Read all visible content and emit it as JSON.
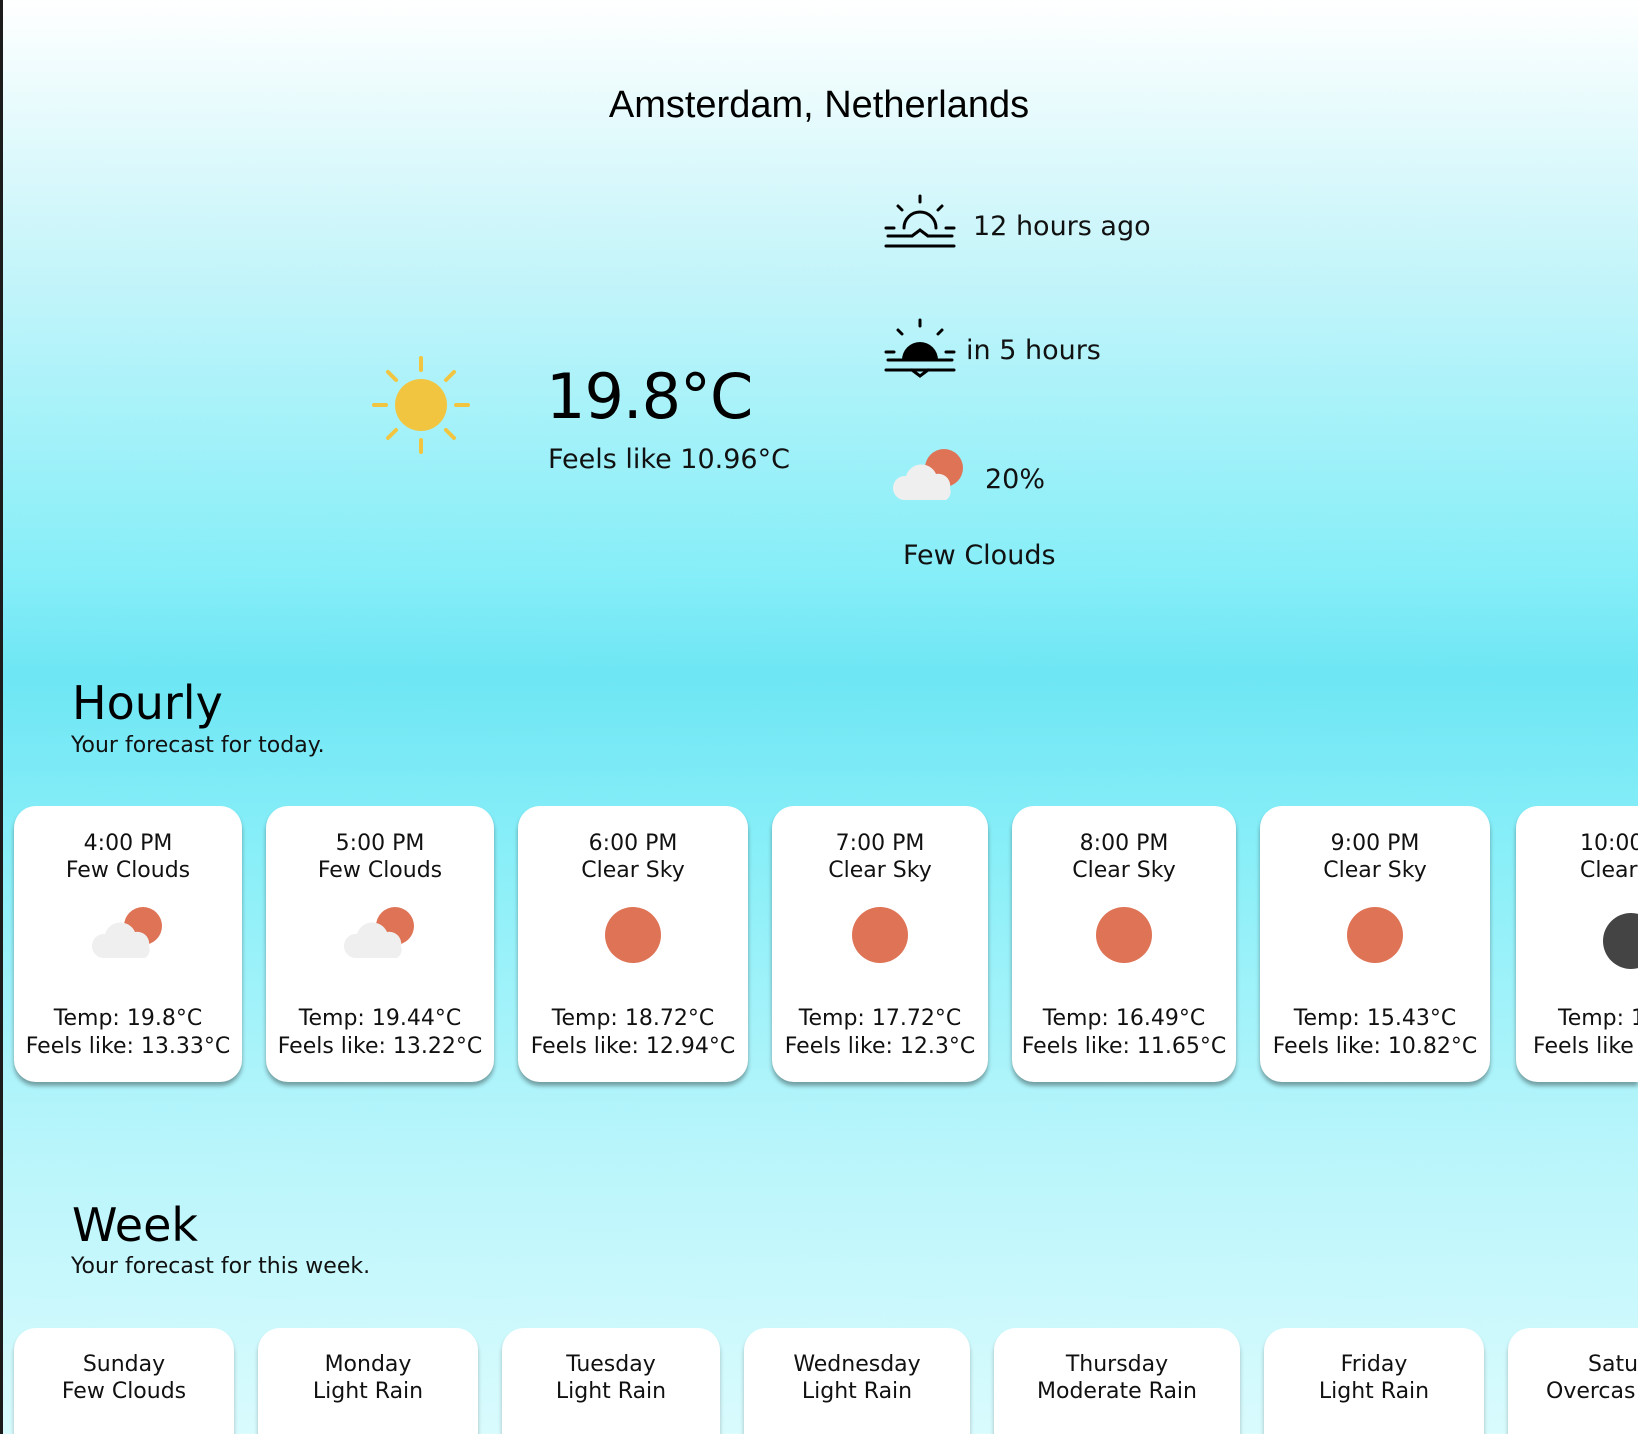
{
  "location": "Amsterdam, Netherlands",
  "current": {
    "icon": "sun-icon",
    "temperature": "19.8°C",
    "feels_like": "Feels like 10.96°C",
    "sunrise": {
      "icon": "sunrise-icon",
      "text": "12 hours ago"
    },
    "sunset": {
      "icon": "sunset-icon",
      "text": "in 5 hours"
    },
    "clouds": {
      "icon": "few-clouds-icon",
      "percent": "20%"
    },
    "condition": "Few Clouds"
  },
  "hourly": {
    "title": "Hourly",
    "subtitle": "Your forecast for today.",
    "cards": [
      {
        "time": "4:00 PM",
        "desc": "Few Clouds",
        "icon": "few-clouds-icon",
        "temp": "Temp: 19.8°C",
        "feels": "Feels like: 13.33°C"
      },
      {
        "time": "5:00 PM",
        "desc": "Few Clouds",
        "icon": "few-clouds-icon",
        "temp": "Temp: 19.44°C",
        "feels": "Feels like: 13.22°C"
      },
      {
        "time": "6:00 PM",
        "desc": "Clear Sky",
        "icon": "clear-sky-icon",
        "temp": "Temp: 18.72°C",
        "feels": "Feels like: 12.94°C"
      },
      {
        "time": "7:00 PM",
        "desc": "Clear Sky",
        "icon": "clear-sky-icon",
        "temp": "Temp: 17.72°C",
        "feels": "Feels like: 12.3°C"
      },
      {
        "time": "8:00 PM",
        "desc": "Clear Sky",
        "icon": "clear-sky-icon",
        "temp": "Temp: 16.49°C",
        "feels": "Feels like: 11.65°C"
      },
      {
        "time": "9:00 PM",
        "desc": "Clear Sky",
        "icon": "clear-sky-icon",
        "temp": "Temp: 15.43°C",
        "feels": "Feels like: 10.82°C"
      },
      {
        "time": "10:00",
        "desc": "Clear",
        "icon": "clear-night-icon",
        "temp": "Temp: 1",
        "feels": "Feels like"
      }
    ]
  },
  "week": {
    "title": "Week",
    "subtitle": "Your forecast for this week.",
    "cards": [
      {
        "day": "Sunday",
        "desc": "Few Clouds"
      },
      {
        "day": "Monday",
        "desc": "Light Rain"
      },
      {
        "day": "Tuesday",
        "desc": "Light Rain"
      },
      {
        "day": "Wednesday",
        "desc": "Light Rain"
      },
      {
        "day": "Thursday",
        "desc": "Moderate Rain"
      },
      {
        "day": "Friday",
        "desc": "Light Rain"
      },
      {
        "day": "Satu",
        "desc": "Overcas"
      }
    ]
  },
  "colors": {
    "sun": "#f2c540",
    "sun_orange": "#de7356",
    "cloud": "#efefef",
    "night": "#444444"
  }
}
